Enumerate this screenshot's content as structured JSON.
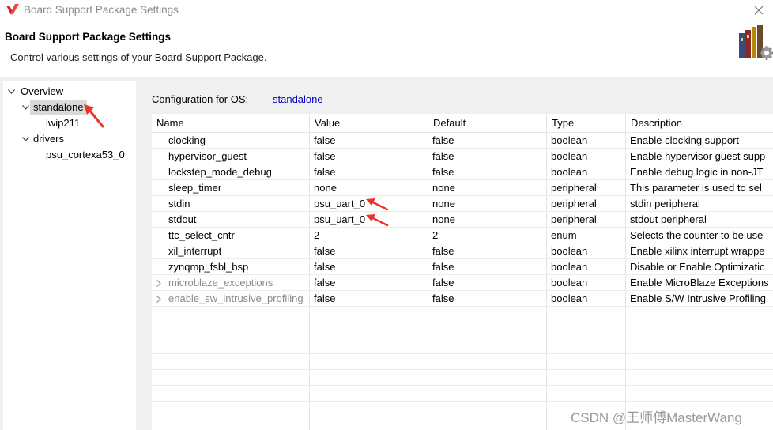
{
  "window": {
    "title": "Board Support Package Settings"
  },
  "header": {
    "title": "Board Support Package Settings",
    "subtitle": "Control various settings of your Board Support Package."
  },
  "tree": {
    "items": [
      {
        "label": "Overview",
        "expanded": true
      },
      {
        "label": "standalone",
        "expanded": true,
        "selected": true
      },
      {
        "label": "lwip211"
      },
      {
        "label": "drivers",
        "expanded": true
      },
      {
        "label": "psu_cortexa53_0"
      }
    ]
  },
  "config": {
    "label": "Configuration for OS:",
    "os": "standalone"
  },
  "table": {
    "columns": [
      "Name",
      "Value",
      "Default",
      "Type",
      "Description"
    ],
    "rows": [
      {
        "name": "clocking",
        "value": "false",
        "default": "false",
        "type": "boolean",
        "description": "Enable clocking support"
      },
      {
        "name": "hypervisor_guest",
        "value": "false",
        "default": "false",
        "type": "boolean",
        "description": "Enable hypervisor guest supp"
      },
      {
        "name": "lockstep_mode_debug",
        "value": "false",
        "default": "false",
        "type": "boolean",
        "description": "Enable debug logic in non-JT"
      },
      {
        "name": "sleep_timer",
        "value": "none",
        "default": "none",
        "type": "peripheral",
        "description": "This parameter is used to sel"
      },
      {
        "name": "stdin",
        "value": "psu_uart_0",
        "default": "none",
        "type": "peripheral",
        "description": "stdin peripheral"
      },
      {
        "name": "stdout",
        "value": "psu_uart_0",
        "default": "none",
        "type": "peripheral",
        "description": "stdout peripheral"
      },
      {
        "name": "ttc_select_cntr",
        "value": "2",
        "default": "2",
        "type": "enum",
        "description": "Selects the counter to be use"
      },
      {
        "name": "xil_interrupt",
        "value": "false",
        "default": "false",
        "type": "boolean",
        "description": "Enable xilinx interrupt wrappe"
      },
      {
        "name": "zynqmp_fsbl_bsp",
        "value": "false",
        "default": "false",
        "type": "boolean",
        "description": "Disable or Enable Optimizatic"
      },
      {
        "name": "microblaze_exceptions",
        "value": "false",
        "default": "false",
        "type": "boolean",
        "description": "Enable MicroBlaze Exceptions",
        "expandable": true
      },
      {
        "name": "enable_sw_intrusive_profiling",
        "value": "false",
        "default": "false",
        "type": "boolean",
        "description": "Enable S/W Intrusive Profiling",
        "expandable": true
      }
    ]
  },
  "watermark": "CSDN @王师傅MasterWang",
  "colors": {
    "link_blue": "#0000cc",
    "annotation_red": "#e8342e",
    "selection_gray": "#d9d9d9"
  }
}
